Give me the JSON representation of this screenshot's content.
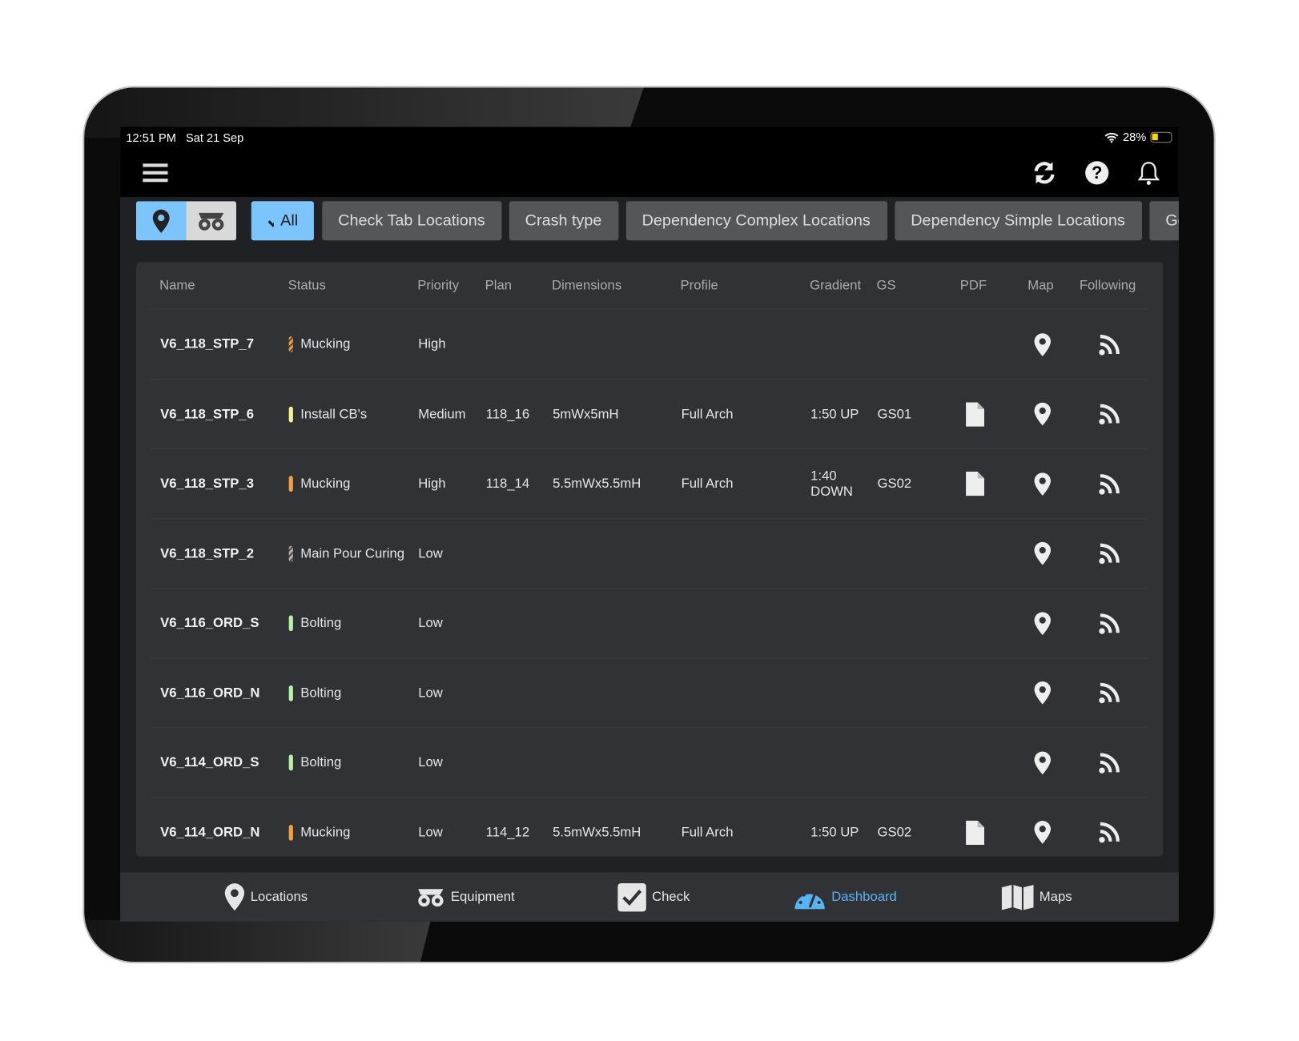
{
  "status_bar": {
    "time": "12:51 PM",
    "date": "Sat 21 Sep",
    "battery": "28%",
    "battery_level": 0.28
  },
  "colors": {
    "accent": "#7cc4fc",
    "active_nav": "#5ab2f6",
    "button": "#555658",
    "panel": "#313236"
  },
  "filters": {
    "view_toggle": [
      "location-pin",
      "equipment"
    ],
    "buttons": [
      {
        "label": "All",
        "selected": true
      },
      {
        "label": "Check Tab Locations"
      },
      {
        "label": "Crash type"
      },
      {
        "label": "Dependency Complex Locations"
      },
      {
        "label": "Dependency Simple Locations"
      },
      {
        "label": "Ge"
      }
    ]
  },
  "table": {
    "columns": [
      "Name",
      "Status",
      "Priority",
      "Plan",
      "Dimensions",
      "Profile",
      "Gradient",
      "GS",
      "PDF",
      "Map",
      "Following"
    ],
    "rows": [
      {
        "name": "V6_118_STP_7",
        "status": "Mucking",
        "status_color": "#f0a040",
        "striped": true,
        "priority": "High",
        "plan": "",
        "dimensions": "",
        "profile": "",
        "gradient": "",
        "gs": "",
        "pdf": false
      },
      {
        "name": "V6_118_STP_6",
        "status": "Install CB's",
        "status_color": "#f7f28c",
        "striped": false,
        "priority": "Medium",
        "plan": "118_16",
        "dimensions": "5mWx5mH",
        "profile": "Full Arch",
        "gradient": "1:50 UP",
        "gs": "GS01",
        "pdf": true
      },
      {
        "name": "V6_118_STP_3",
        "status": "Mucking",
        "status_color": "#f5a040",
        "striped": false,
        "priority": "High",
        "plan": "118_14",
        "dimensions": "5.5mWx5.5mH",
        "profile": "Full Arch",
        "gradient": "1:40 DOWN",
        "gs": "GS02",
        "pdf": true
      },
      {
        "name": "V6_118_STP_2",
        "status": "Main Pour Curing",
        "status_color": "#b0b0b0",
        "striped": true,
        "priority": "Low",
        "plan": "",
        "dimensions": "",
        "profile": "",
        "gradient": "",
        "gs": "",
        "pdf": false
      },
      {
        "name": "V6_116_ORD_S",
        "status": "Bolting",
        "status_color": "#b9f0a9",
        "striped": false,
        "priority": "Low",
        "plan": "",
        "dimensions": "",
        "profile": "",
        "gradient": "",
        "gs": "",
        "pdf": false
      },
      {
        "name": "V6_116_ORD_N",
        "status": "Bolting",
        "status_color": "#b9f0a9",
        "striped": false,
        "priority": "Low",
        "plan": "",
        "dimensions": "",
        "profile": "",
        "gradient": "",
        "gs": "",
        "pdf": false
      },
      {
        "name": "V6_114_ORD_S",
        "status": "Bolting",
        "status_color": "#b9f0a9",
        "striped": false,
        "priority": "Low",
        "plan": "",
        "dimensions": "",
        "profile": "",
        "gradient": "",
        "gs": "",
        "pdf": false
      },
      {
        "name": "V6_114_ORD_N",
        "status": "Mucking",
        "status_color": "#f5a040",
        "striped": false,
        "priority": "Low",
        "plan": "114_12",
        "dimensions": "5.5mWx5.5mH",
        "profile": "Full Arch",
        "gradient": "1:50 UP",
        "gs": "GS02",
        "pdf": true
      }
    ]
  },
  "bottom_nav": [
    {
      "label": "Locations",
      "icon": "location-pin"
    },
    {
      "label": "Equipment",
      "icon": "dump-truck"
    },
    {
      "label": "Check",
      "icon": "checkbox"
    },
    {
      "label": "Dashboard",
      "icon": "gauge",
      "active": true
    },
    {
      "label": "Maps",
      "icon": "map"
    }
  ]
}
